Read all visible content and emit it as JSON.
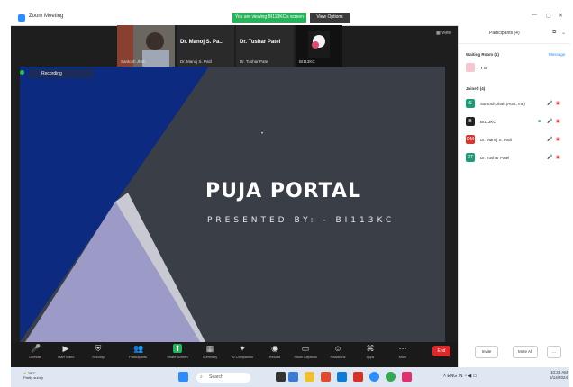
{
  "window": {
    "title": "Zoom Meeting"
  },
  "share_banner": "You are viewing BI113KC's screen",
  "stop_button": "View Options",
  "video_tiles": [
    {
      "name": "Santosh Jhah"
    },
    {
      "big": "Dr. Manoj  S. Pa...",
      "name": "Dr. Manoj S. Patil"
    },
    {
      "big": "Dr. Tushar Patel",
      "name": "Dr. Tushar Patel"
    },
    {
      "name": "BI113KC"
    }
  ],
  "recording": "Recording",
  "slide": {
    "title": "PUJA PORTAL",
    "subtitle": "PRESENTED BY: - BI113KC"
  },
  "view_label": "View",
  "toolbar": [
    {
      "icon": "🎤",
      "label": "Unmute"
    },
    {
      "icon": "▶",
      "label": "Start Video"
    },
    {
      "icon": "⛨",
      "label": "Security"
    },
    {
      "icon": "👥",
      "label": "Participants"
    },
    {
      "icon": "⬆",
      "label": "Share Screen"
    },
    {
      "icon": "▦",
      "label": "Summary"
    },
    {
      "icon": "✦",
      "label": "AI Companion"
    },
    {
      "icon": "◉",
      "label": "Record"
    },
    {
      "icon": "▭",
      "label": "Show Captions"
    },
    {
      "icon": "☺",
      "label": "Reactions"
    },
    {
      "icon": "⌘",
      "label": "Apps"
    },
    {
      "icon": "⋯",
      "label": "More"
    }
  ],
  "end_button": "End",
  "panel": {
    "title": "Participants (4)",
    "waiting_header": "Waiting Room (1)",
    "admit_all": "Message",
    "waiting": [
      {
        "initial": "",
        "name": "Y B",
        "color": "#f6c7d0"
      }
    ],
    "joined_header": "Joined (4)",
    "joined": [
      {
        "initial": "S",
        "name": "Santosh Jhah (Host, me)",
        "color": "#1f9b7a"
      },
      {
        "initial": "B",
        "name": "BI113KC",
        "color": "#222222"
      },
      {
        "initial": "DM",
        "name": "Dr. Manoj S. Patil",
        "color": "#d9352b"
      },
      {
        "initial": "DT",
        "name": "Dr. Tushar Patel",
        "color": "#1f9b7a"
      }
    ],
    "btn_invite": "Invite",
    "btn_mute": "Mute All",
    "btn_more": "..."
  },
  "taskbar": {
    "weather_temp": "28°C",
    "weather_desc": "Partly sunny",
    "search": "Search",
    "tray": "ENG  IN",
    "time": "10:24 AM",
    "date": "5/14/2024"
  },
  "colors": {
    "accent": "#2d8cff",
    "end": "#e02828",
    "stage": "#3a3f47",
    "navy": "#0c2a80",
    "lavender": "#9c9ac6"
  }
}
